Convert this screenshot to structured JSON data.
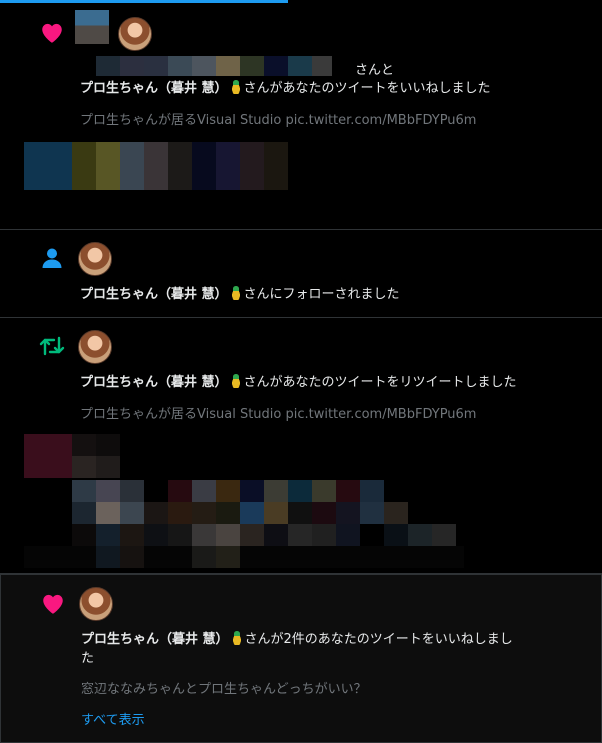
{
  "notifications": [
    {
      "type": "like",
      "icon": "heart-icon",
      "line_prefix": "さんと",
      "user_name": "プロ生ちゃん（暮井 慧）",
      "action_text": "さんがあなたのツイートをいいねしました",
      "tweet_text": "プロ生ちゃんが居るVisual Studio pic.twitter.com/MBbFDYPu6m"
    },
    {
      "type": "follow",
      "icon": "person-icon",
      "user_name": "プロ生ちゃん（暮井 慧）",
      "action_text": "さんにフォローされました"
    },
    {
      "type": "retweet",
      "icon": "retweet-icon",
      "user_name": "プロ生ちゃん（暮井 慧）",
      "action_text": "さんがあなたのツイートをリツイートしました",
      "tweet_text": "プロ生ちゃんが居るVisual Studio pic.twitter.com/MBbFDYPu6m"
    },
    {
      "type": "like",
      "icon": "heart-icon",
      "user_name": "プロ生ちゃん（暮井 慧）",
      "action_text_line1": "さんが2件のあなたのツイートをいいねしまし",
      "action_text_line2": "た",
      "tweet_text": "窓辺ななみちゃんとプロ生ちゃんどっちがいい？",
      "show_all_link": "すべて表示"
    }
  ],
  "colors": {
    "heart": "#f91880",
    "follow": "#1d9bf0",
    "retweet": "#00ba7c",
    "link": "#1d9bf0",
    "muted": "#71767b"
  }
}
